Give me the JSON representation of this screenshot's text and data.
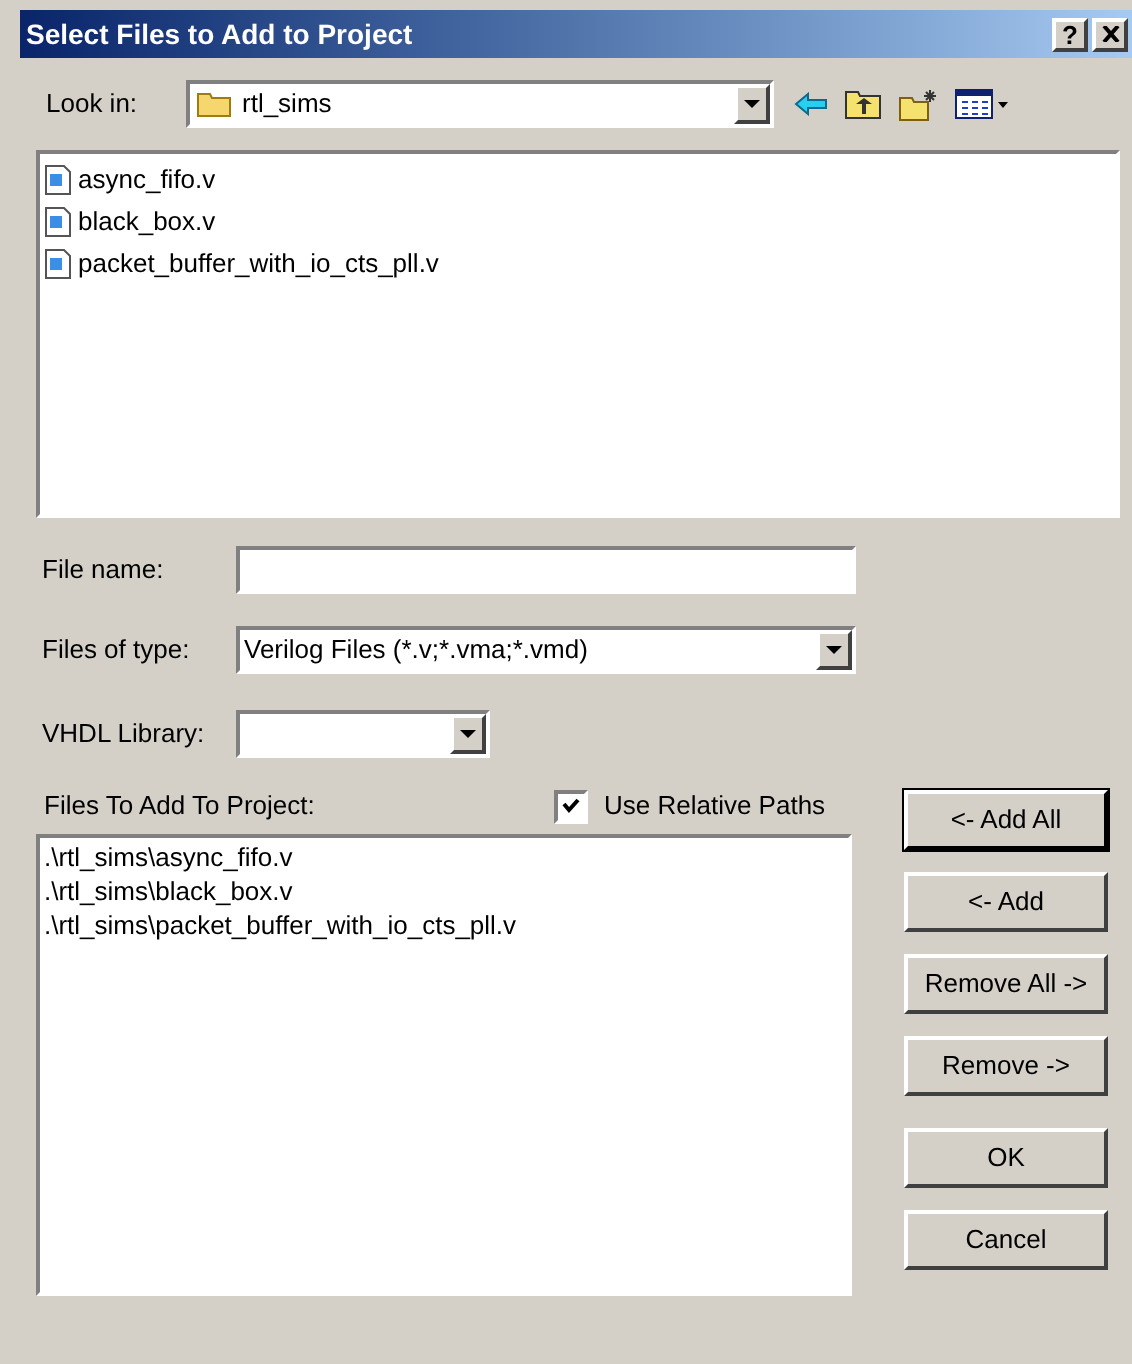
{
  "window": {
    "title": "Select Files to Add to Project",
    "help": "?"
  },
  "look_in": {
    "label": "Look in:",
    "value": "rtl_sims"
  },
  "files": [
    {
      "name": "async_fifo.v"
    },
    {
      "name": "black_box.v"
    },
    {
      "name": "packet_buffer_with_io_cts_pll.v"
    }
  ],
  "file_name": {
    "label": "File name:"
  },
  "files_of_type": {
    "label": "Files of type:",
    "value": "Verilog Files (*.v;*.vma;*.vmd)"
  },
  "vhdl_library": {
    "label": "VHDL Library:"
  },
  "files_to_add": {
    "label": "Files To Add To Project:",
    "use_relative_paths": {
      "label": "Use Relative Paths",
      "checked": true
    },
    "items": [
      ".\\rtl_sims\\async_fifo.v",
      ".\\rtl_sims\\black_box.v",
      ".\\rtl_sims\\packet_buffer_with_io_cts_pll.v"
    ]
  },
  "buttons": [
    {
      "label": "<- Add All",
      "default": true
    },
    {
      "label": "<- Add",
      "default": false
    },
    {
      "label": "Remove All ->",
      "default": false
    },
    {
      "label": "Remove ->",
      "default": false
    },
    {
      "label": "OK",
      "default": false
    },
    {
      "label": "Cancel",
      "default": false
    }
  ]
}
